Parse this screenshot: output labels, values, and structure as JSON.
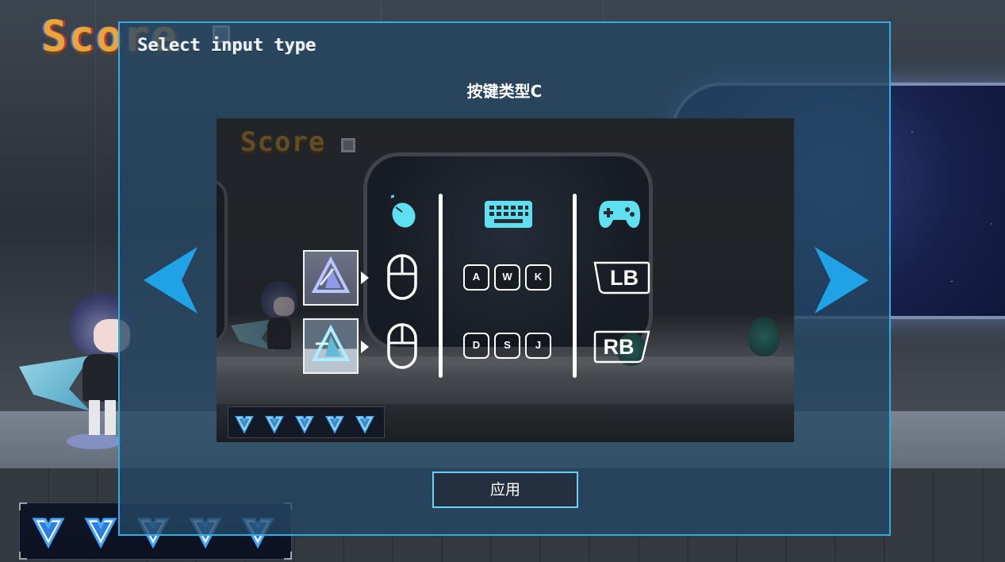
{
  "hud": {
    "score_label": "Score",
    "lives_icons": [
      "heart-crystal-icon",
      "heart-crystal-icon",
      "heart-crystal-icon",
      "heart-crystal-icon",
      "heart-crystal-icon"
    ]
  },
  "modal": {
    "header": "Select input type",
    "scheme_title": "按键类型C",
    "apply_label": "应用",
    "prev_icon": "arrow-left-icon",
    "next_icon": "arrow-right-icon"
  },
  "preview": {
    "score_label": "Score",
    "columns": {
      "mouse_icon": "mouse-icon",
      "keyboard_icon": "keyboard-icon",
      "gamepad_icon": "gamepad-icon"
    },
    "rows": [
      {
        "skill_icon": "triangle-skill-icon",
        "mouse_icon": "mouse-left-button-icon",
        "keys": [
          "A",
          "W",
          "K"
        ],
        "gamepad": "LB"
      },
      {
        "skill_icon": "triangle-skill-alt-icon",
        "mouse_icon": "mouse-right-button-icon",
        "keys": [
          "D",
          "S",
          "J"
        ],
        "gamepad": "RB"
      }
    ]
  },
  "colors": {
    "accent": "#2eaee6",
    "icon_cyan": "#5fe0f0",
    "arrow_blue": "#1fa3e6",
    "score_gold": "#e9a43a"
  }
}
